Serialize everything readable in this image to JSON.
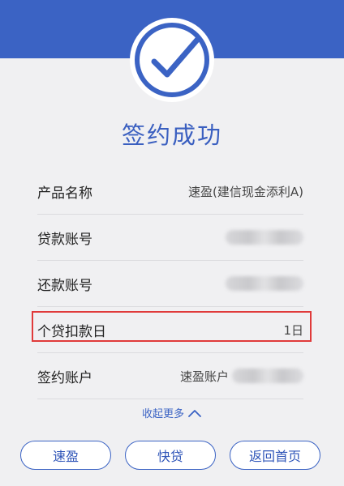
{
  "header": {
    "icon": "checkmark-icon",
    "title": "签约成功",
    "accent_color": "#3b63c4",
    "highlight_color": "#e03a3a"
  },
  "details": {
    "rows": [
      {
        "label": "产品名称",
        "value": "速盈(建信现金添利A)"
      },
      {
        "label": "贷款账号",
        "value": ""
      },
      {
        "label": "还款账号",
        "value": ""
      },
      {
        "label": "个贷扣款日",
        "value": "1日"
      },
      {
        "label": "签约账户",
        "value": "速盈账户"
      }
    ]
  },
  "collapse": {
    "label": "收起更多",
    "icon": "chevron-up-icon"
  },
  "buttons": {
    "suying": "速盈",
    "kuaidai": "快贷",
    "home": "返回首页"
  }
}
